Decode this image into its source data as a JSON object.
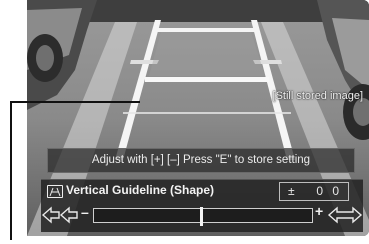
{
  "overlay": {
    "still_label": "[Still stored image]",
    "hint": "Adjust with [+] [–]    Press \"E\" to store setting"
  },
  "setting": {
    "title": "Vertical Guideline (Shape)",
    "value_sign": "±",
    "value": "0 0",
    "minus_label": "–",
    "plus_label": "+",
    "level": 0,
    "icon": "guideline-icon"
  },
  "colors": {
    "panel_text": "#f3f3f3",
    "track_border": "#cfcfcf"
  }
}
